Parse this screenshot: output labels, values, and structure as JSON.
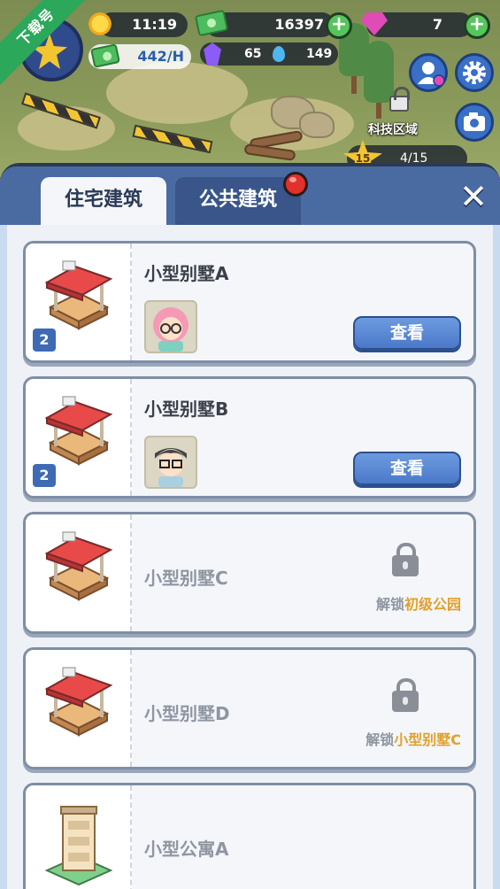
{
  "watermark": "下载号",
  "hud": {
    "time": "11:19",
    "cash": "16397",
    "gems": "7",
    "income": "442/H",
    "crystals": "65",
    "water": "149",
    "zone_label": "科技区域",
    "zone_level": "15",
    "zone_progress": "4/15",
    "icons": {
      "time": "sun-icon",
      "cash": "cash-icon",
      "gems": "gem-icon",
      "income": "income-icon",
      "crystals": "crystal-icon",
      "water": "water-drop-icon",
      "profile": "profile-icon",
      "settings": "gear-icon",
      "camera": "camera-icon",
      "zone_lock": "lock-icon"
    }
  },
  "panel": {
    "tabs": [
      {
        "label": "住宅建筑",
        "active": true
      },
      {
        "label": "公共建筑",
        "active": false,
        "has_notification": true
      }
    ],
    "close_icon": "close-icon"
  },
  "buildings": [
    {
      "name": "小型别墅A",
      "count": "2",
      "status": "owned",
      "action": "查看",
      "resident": "girl-avatar"
    },
    {
      "name": "小型别墅B",
      "count": "2",
      "status": "owned",
      "action": "查看",
      "resident": "boy-avatar"
    },
    {
      "name": "小型别墅C",
      "status": "locked",
      "unlock_prefix": "解锁",
      "unlock_target": "初级公园"
    },
    {
      "name": "小型别墅D",
      "status": "locked",
      "unlock_prefix": "解锁",
      "unlock_target": "小型别墅C"
    },
    {
      "name": "小型公寓A",
      "status": "locked"
    }
  ],
  "colors": {
    "panel_header": "#4a6aa2",
    "button_blue": "#4a79c8",
    "unlock_highlight": "#e2a02a",
    "notification_red": "#e2302b",
    "plus_green": "#56c55a"
  }
}
